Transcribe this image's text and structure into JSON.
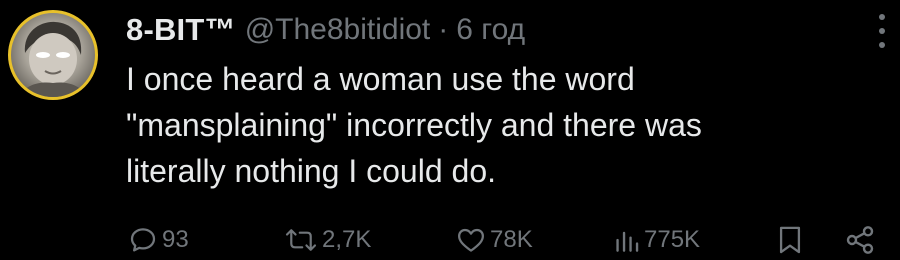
{
  "tweet": {
    "author": {
      "display_name": "8-BIT™",
      "handle": "@The8bitidiot",
      "separator": "·",
      "time": "6 год"
    },
    "text_lines": [
      "I once heard a woman use the word",
      "\"mansplaining\" incorrectly and there was",
      "literally nothing I could do."
    ],
    "stats": {
      "replies": "93",
      "reposts": "2,7K",
      "likes": "78K",
      "views": "775K"
    }
  },
  "icons": {
    "avatar": "avatar-photo",
    "more": "more-vertical-icon",
    "reply": "reply-icon",
    "repost": "repost-icon",
    "like": "heart-icon",
    "views": "views-icon",
    "bookmark": "bookmark-icon",
    "share": "share-icon"
  },
  "colors": {
    "background": "#000000",
    "text": "#e7e9ea",
    "secondary": "#71767b",
    "avatar_ring": "#e8c12a"
  }
}
